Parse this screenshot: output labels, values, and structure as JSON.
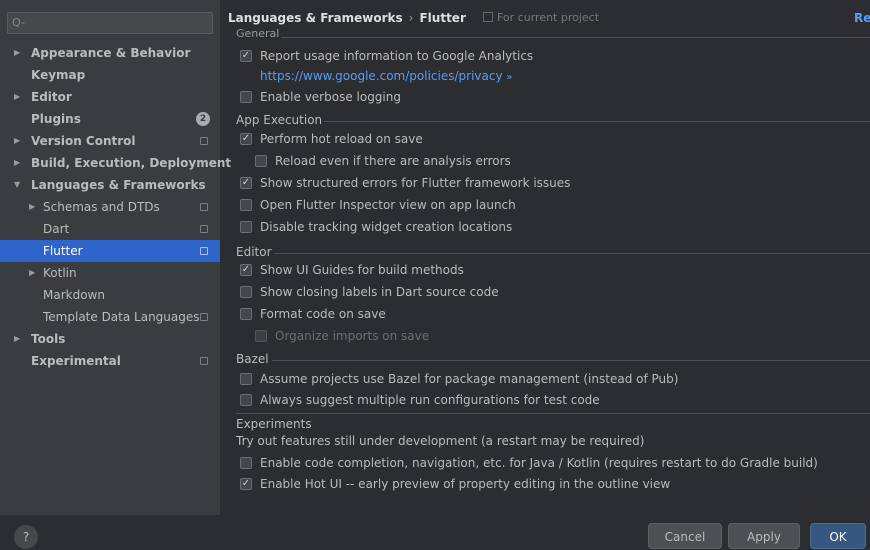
{
  "search": {
    "placeholder": ""
  },
  "sidebar": {
    "items": [
      {
        "label": "Appearance & Behavior"
      },
      {
        "label": "Keymap"
      },
      {
        "label": "Editor"
      },
      {
        "label": "Plugins",
        "badge": "2"
      },
      {
        "label": "Version Control"
      },
      {
        "label": "Build, Execution, Deployment"
      },
      {
        "label": "Languages & Frameworks"
      },
      {
        "label": "Schemas and DTDs"
      },
      {
        "label": "Dart"
      },
      {
        "label": "Flutter"
      },
      {
        "label": "Kotlin"
      },
      {
        "label": "Markdown"
      },
      {
        "label": "Template Data Languages"
      },
      {
        "label": "Tools"
      },
      {
        "label": "Experimental"
      }
    ]
  },
  "header": {
    "breadcrumb_parent": "Languages & Frameworks",
    "breadcrumb_sep": "›",
    "breadcrumb_current": "Flutter",
    "scope": "For current project",
    "reset": "Re"
  },
  "general": {
    "title": "General",
    "report_usage": "Report usage information to Google Analytics",
    "privacy_link": "https://www.google.com/policies/privacy",
    "privacy_arrow": "»",
    "verbose_logging": "Enable verbose logging"
  },
  "app_execution": {
    "title": "App Execution",
    "hot_reload": "Perform hot reload on save",
    "reload_errors": "Reload even if there are analysis errors",
    "structured_errors": "Show structured errors for Flutter framework issues",
    "open_inspector": "Open Flutter Inspector view on app launch",
    "disable_tracking": "Disable tracking widget creation locations"
  },
  "editor": {
    "title": "Editor",
    "ui_guides": "Show UI Guides for build methods",
    "closing_labels": "Show closing labels in Dart source code",
    "format_on_save": "Format code on save",
    "organize_imports": "Organize imports on save"
  },
  "bazel": {
    "title": "Bazel",
    "assume_bazel": "Assume projects use Bazel for package management (instead of Pub)",
    "suggest_run": "Always suggest multiple run configurations for test code"
  },
  "experiments": {
    "title": "Experiments",
    "description": "Try out features still under development (a restart may be required)",
    "code_completion": "Enable code completion, navigation, etc. for Java / Kotlin (requires restart to do Gradle build)",
    "hot_ui": "Enable Hot UI -- early preview of property editing in the outline view"
  },
  "footer": {
    "help": "?",
    "cancel": "Cancel",
    "apply": "Apply",
    "ok": "OK"
  },
  "colors": {
    "selection": "#2f65ca",
    "link": "#589df6",
    "primary_button": "#365880"
  }
}
